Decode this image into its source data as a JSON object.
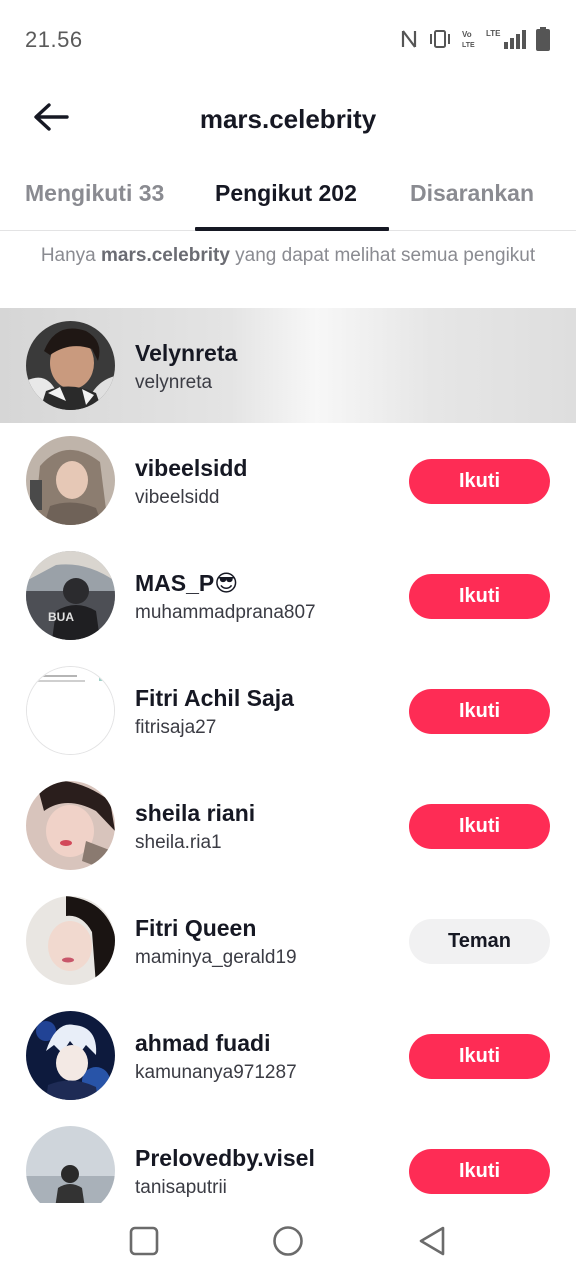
{
  "status_bar": {
    "time": "21.56",
    "icons": [
      "nfc-icon",
      "vibrate-icon",
      "volte-icon",
      "lte-signal-icon",
      "battery-icon"
    ]
  },
  "header": {
    "title": "mars.celebrity",
    "back_icon": "arrow-left-icon"
  },
  "tabs": [
    {
      "label": "Mengikuti 33",
      "active": false
    },
    {
      "label": "Pengikut 202",
      "active": true
    },
    {
      "label": "Disarankan",
      "active": false
    }
  ],
  "notice": {
    "prefix": "Hanya ",
    "username": "mars.celebrity",
    "suffix": " yang dapat melihat semua pengikut"
  },
  "followers": [
    {
      "name": "Velynreta",
      "handle": "velynreta",
      "button": ""
    },
    {
      "name": "vibeelsidd",
      "handle": "vibeelsidd",
      "button": "Ikuti"
    },
    {
      "name": "MAS_P😎",
      "handle": "muhammadprana807",
      "button": "Ikuti"
    },
    {
      "name": "Fitri Achil Saja",
      "handle": "fitrisaja27",
      "button": "Ikuti"
    },
    {
      "name": "sheila riani",
      "handle": "sheila.ria1",
      "button": "Ikuti"
    },
    {
      "name": "Fitri Queen",
      "handle": "maminya_gerald19",
      "button": "Teman"
    },
    {
      "name": "ahmad fuadi",
      "handle": "kamunanya971287",
      "button": "Ikuti"
    },
    {
      "name": "Prelovedby.visel",
      "handle": "tanisaputrii",
      "button": "Ikuti"
    }
  ],
  "colors": {
    "accent": "#fe2c55",
    "friend_button": "#f1f1f2",
    "text_primary": "#161823",
    "text_secondary": "#8a8b91"
  },
  "navbar": {
    "icons": [
      "recents-square-icon",
      "home-circle-icon",
      "back-triangle-icon"
    ]
  }
}
